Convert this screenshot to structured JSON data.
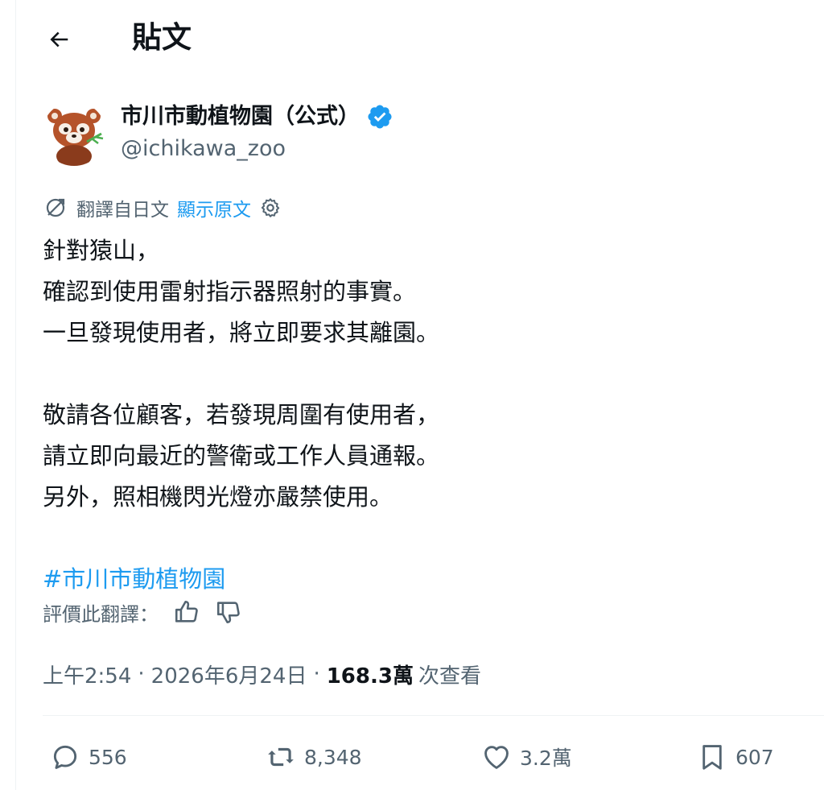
{
  "header": {
    "title": "貼文"
  },
  "author": {
    "display_name": "市川市動植物園（公式）",
    "handle": "@ichikawa_zoo"
  },
  "translation": {
    "label": "翻譯自日文",
    "show_original": "顯示原文"
  },
  "tweet": {
    "lines": [
      "針對猿山，",
      "確認到使用雷射指示器照射的事實。",
      "一旦發現使用者，將立即要求其離園。",
      "",
      "敬請各位顧客，若發現周圍有使用者，",
      "請立即向最近的警衛或工作人員通報。",
      "另外，照相機閃光燈亦嚴禁使用。",
      ""
    ],
    "hashtag": "#市川市動植物園"
  },
  "rate_translation": {
    "label": "評價此翻譯："
  },
  "meta": {
    "time": "上午2:54",
    "date": "2026年6月24日",
    "views_count": "168.3萬",
    "views_label": "次查看",
    "separator": "·"
  },
  "actions": {
    "replies": "556",
    "reposts": "8,348",
    "likes": "3.2萬",
    "bookmarks": "607"
  },
  "colors": {
    "accent": "#1d9bf0",
    "secondary_text": "#536471",
    "primary_text": "#0f1419",
    "divider": "#eff3f4"
  },
  "icons": {
    "back": "arrow-left-icon",
    "verified": "verified-badge-icon",
    "translate": "translate-icon",
    "settings": "gear-icon",
    "thumbs_up": "thumbs-up-icon",
    "thumbs_down": "thumbs-down-icon",
    "reply": "reply-icon",
    "repost": "repost-icon",
    "like": "heart-icon",
    "bookmark": "bookmark-icon"
  }
}
